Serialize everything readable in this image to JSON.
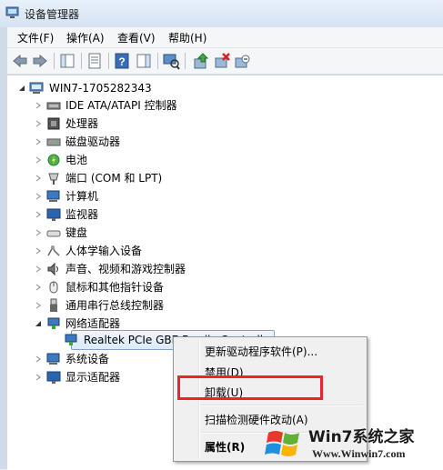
{
  "window": {
    "title": "设备管理器"
  },
  "menu": [
    "文件(F)",
    "操作(A)",
    "查看(V)",
    "帮助(H)"
  ],
  "toolbar": {
    "icons": [
      "back-arrow-icon",
      "forward-arrow-icon",
      "console-tree-icon",
      "properties-icon",
      "help-icon",
      "action-pane-icon",
      "computer-scan-icon",
      "update-driver-icon",
      "disable-device-icon",
      "uninstall-device-icon"
    ]
  },
  "tree": {
    "root": "WIN7-1705282343",
    "categories": [
      "IDE ATA/ATAPI 控制器",
      "处理器",
      "磁盘驱动器",
      "电池",
      "端口 (COM 和 LPT)",
      "计算机",
      "监视器",
      "键盘",
      "人体学输入设备",
      "声音、视频和游戏控制器",
      "鼠标和其他指针设备",
      "通用串行总线控制器",
      "网络适配器",
      "系统设备",
      "显示适配器"
    ],
    "selected_device": "Realtek PCIe GBE Family Controller"
  },
  "context_menu": {
    "items": [
      "更新驱动程序软件(P)...",
      "禁用(D)",
      "卸载(U)",
      "扫描检测硬件改动(A)",
      "属性(R)"
    ],
    "highlighted": "卸载(U)"
  },
  "watermark": {
    "title": "Win7系统之家",
    "url": "Www.Winwin7.com"
  },
  "colors": {
    "highlight_border": "#e8262a",
    "selection": "#dbeafc",
    "titlebar": "#d5e2f1"
  }
}
